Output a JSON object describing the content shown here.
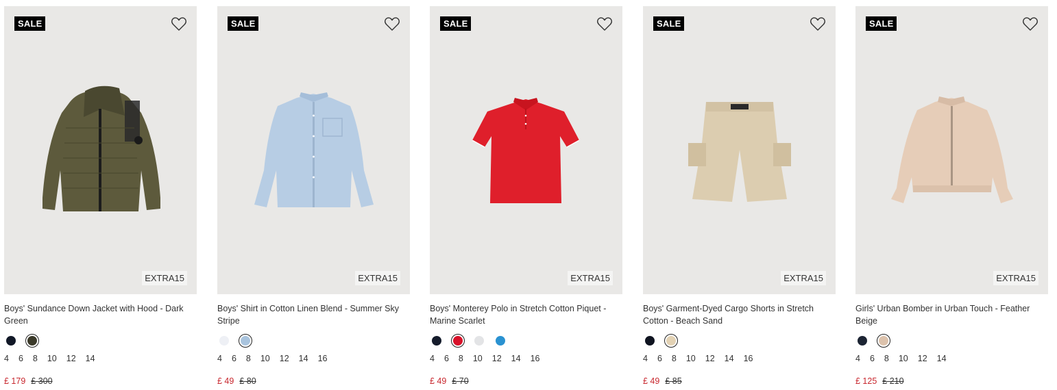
{
  "products": [
    {
      "badge": "SALE",
      "promo": "EXTRA15",
      "title": "Boys' Sundance Down Jacket with Hood - Dark Green",
      "colors": [
        "#111827",
        "#3b3a2a"
      ],
      "selected_color": 1,
      "sizes": [
        "4",
        "6",
        "8",
        "10",
        "12",
        "14"
      ],
      "price": "£ 179",
      "original_price": "£ 300",
      "icon": "heart-icon"
    },
    {
      "badge": "SALE",
      "promo": "EXTRA15",
      "title": "Boys' Shirt in Cotton Linen Blend - Summer Sky Stripe",
      "colors": [
        "#eef0f5",
        "#a9c4de"
      ],
      "selected_color": 1,
      "sizes": [
        "4",
        "6",
        "8",
        "10",
        "12",
        "14",
        "16"
      ],
      "price": "£ 49",
      "original_price": "£ 80",
      "icon": "heart-icon"
    },
    {
      "badge": "SALE",
      "promo": "EXTRA15",
      "title": "Boys' Monterey Polo in Stretch Cotton Piquet - Marine Scarlet",
      "colors": [
        "#151c2c",
        "#d8122a",
        "#e3e4e6",
        "#2a92d1"
      ],
      "selected_color": 1,
      "sizes": [
        "4",
        "6",
        "8",
        "10",
        "12",
        "14",
        "16"
      ],
      "price": "£ 49",
      "original_price": "£ 70",
      "icon": "heart-icon"
    },
    {
      "badge": "SALE",
      "promo": "EXTRA15",
      "title": "Boys' Garment-Dyed Cargo Shorts in Stretch Cotton - Beach Sand",
      "colors": [
        "#0f1420",
        "#e3d2b4"
      ],
      "selected_color": 1,
      "sizes": [
        "4",
        "6",
        "8",
        "10",
        "12",
        "14",
        "16"
      ],
      "price": "£ 49",
      "original_price": "£ 85",
      "icon": "heart-icon"
    },
    {
      "badge": "SALE",
      "promo": "EXTRA15",
      "title": "Girls' Urban Bomber in Urban Touch - Feather Beige",
      "colors": [
        "#1c2433",
        "#dcc2ac"
      ],
      "selected_color": 1,
      "sizes": [
        "4",
        "6",
        "8",
        "10",
        "12",
        "14"
      ],
      "price": "£ 125",
      "original_price": "£ 210",
      "icon": "heart-icon"
    }
  ],
  "colors": {
    "sale_badge_bg": "#000000",
    "price_sale": "#c8272e",
    "image_bg": "#e9e8e6"
  }
}
